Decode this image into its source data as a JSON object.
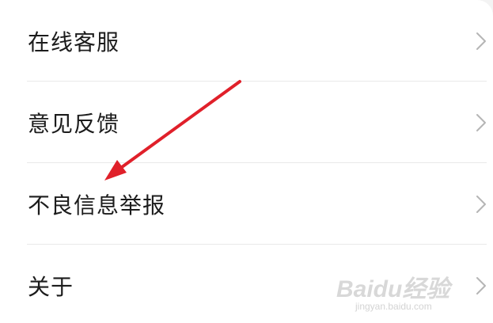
{
  "menu": {
    "items": [
      {
        "label": "在线客服",
        "icon": "chevron-right-icon"
      },
      {
        "label": "意见反馈",
        "icon": "chevron-right-icon"
      },
      {
        "label": "不良信息举报",
        "icon": "chevron-right-icon"
      },
      {
        "label": "关于",
        "icon": "chevron-right-icon"
      }
    ]
  },
  "annotation": {
    "arrow_color": "#e0202a",
    "points_to": "不良信息举报"
  },
  "watermark": {
    "main": "Baidu经验",
    "sub": "jingyan.baidu.com"
  },
  "colors": {
    "text": "#1c1c1c",
    "divider": "#e9e9e9",
    "chevron": "#b5b5b5"
  }
}
